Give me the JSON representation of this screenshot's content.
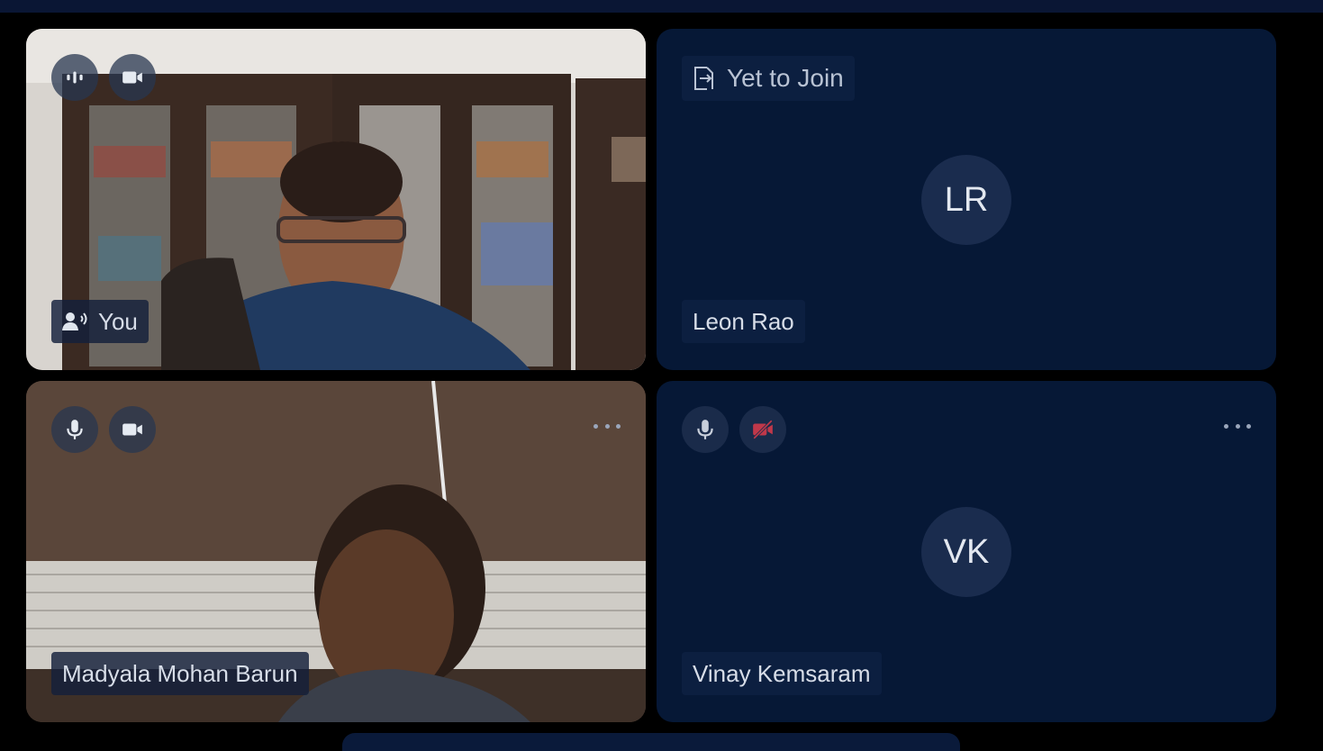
{
  "participants": [
    {
      "id": "you",
      "name": "You",
      "speaking": true,
      "controls": [
        "audio-wave-icon",
        "camera-icon"
      ]
    },
    {
      "id": "leon",
      "name": "Leon Rao",
      "initials": "LR",
      "status": "Yet to Join",
      "status_icon": "exit-door-icon"
    },
    {
      "id": "madyala",
      "name": "Madyala Mohan Barun",
      "controls": [
        "microphone-icon",
        "camera-icon"
      ]
    },
    {
      "id": "vinay",
      "name": "Vinay Kemsaram",
      "initials": "VK",
      "controls": [
        "microphone-icon",
        "camera-off-icon"
      ]
    }
  ],
  "colors": {
    "page_bg": "#000000",
    "tile_bg": "#061836",
    "control_bg": "#1a2b4a",
    "camera_off": "#c0384a",
    "text": "#d7dde8"
  }
}
